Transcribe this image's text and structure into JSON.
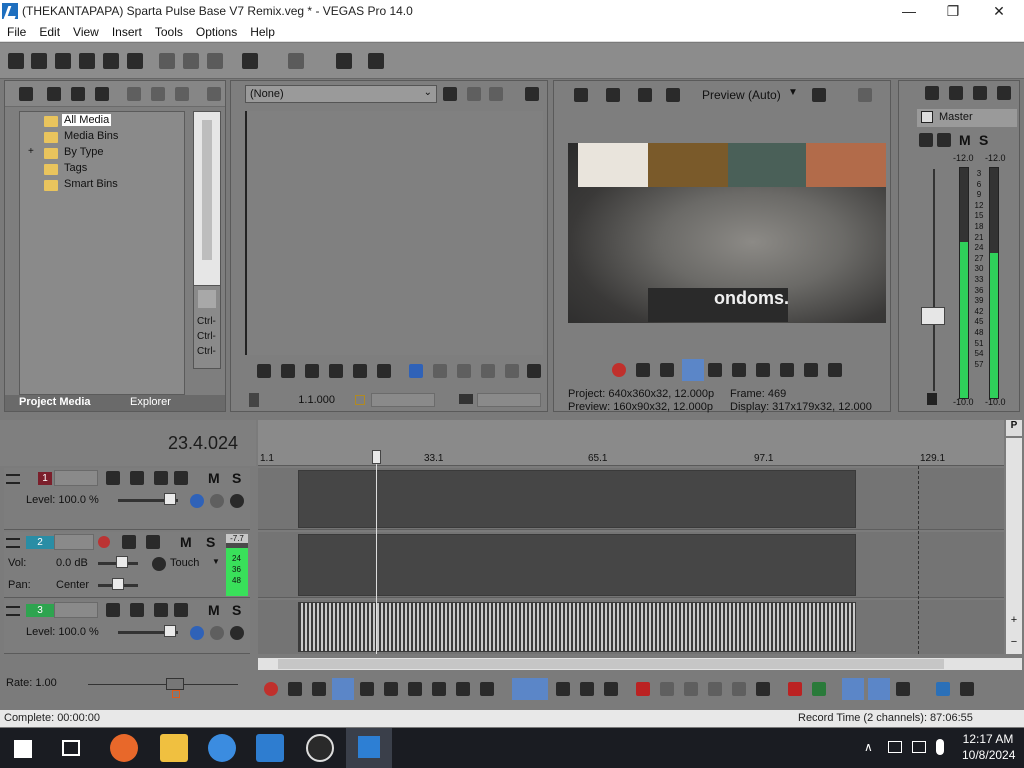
{
  "window": {
    "title": "(THEKANTAPAPA) Sparta Pulse Base V7 Remix.veg * - VEGAS Pro 14.0",
    "controls": [
      "—",
      "❐",
      "✕"
    ]
  },
  "menu": [
    "File",
    "Edit",
    "View",
    "Insert",
    "Tools",
    "Options",
    "Help"
  ],
  "project_media": {
    "tree": [
      "All Media",
      "Media Bins",
      "By Type",
      "Tags",
      "Smart Bins"
    ],
    "expand_symbol": "+",
    "tabs": [
      "Project Media",
      "Explorer"
    ],
    "ctrl_labels": [
      "Ctrl-",
      "Ctrl-",
      "Ctrl-"
    ]
  },
  "trimmer": {
    "dropdown_value": "(None)",
    "timecode": "1.1.000"
  },
  "preview": {
    "quality": "Preview (Auto)",
    "caption_text": "ondoms.",
    "info_project": "Project:  640x360x32, 12.000p",
    "info_preview": "Preview: 160x90x32, 12.000p",
    "info_frame": "Frame:      469",
    "info_display": "Display:    317x179x32, 12.000"
  },
  "master": {
    "label": "Master",
    "m": "M",
    "s": "S",
    "peak_left": "-12.0",
    "peak_right": "-12.0",
    "scale": [
      "3",
      "6",
      "9",
      "12",
      "15",
      "18",
      "21",
      "24",
      "27",
      "30",
      "33",
      "36",
      "39",
      "42",
      "45",
      "48",
      "51",
      "54",
      "57"
    ],
    "floor_left": "-10.0",
    "floor_right": "-10.0",
    "fill_left_pct": 0.68,
    "fill_right_pct": 0.63
  },
  "timeline": {
    "cursor_time": "23.4.024",
    "ruler_marks": [
      "1.1",
      "33.1",
      "65.1",
      "97.1",
      "129.1"
    ],
    "tracks": [
      {
        "num": "1",
        "color": "#7b1f2b",
        "level_label": "Level: 100.0 %",
        "m": "M",
        "s": "S"
      },
      {
        "num": "2",
        "color": "#2a8da5",
        "vol_label": "Vol:",
        "vol_value": "0.0 dB",
        "pan_label": "Pan:",
        "pan_value": "Center",
        "touch": "Touch",
        "m": "M",
        "s": "S",
        "meter_peak": "-7.7",
        "meter_marks": [
          "24",
          "36",
          "48"
        ]
      },
      {
        "num": "3",
        "color": "#2ea44f",
        "level_label": "Level: 100.0 %",
        "m": "M",
        "s": "S"
      }
    ],
    "rate": "Rate: 1.00"
  },
  "status": {
    "left": "Complete: 00:00:00",
    "right": "Record Time (2 channels): 87:06:55"
  },
  "taskbar": {
    "time": "12:17 AM",
    "date": "10/8/2024",
    "tray_chevron": "∧"
  },
  "side_letters": {
    "top": "P",
    "plus": "+",
    "minus": "−"
  }
}
